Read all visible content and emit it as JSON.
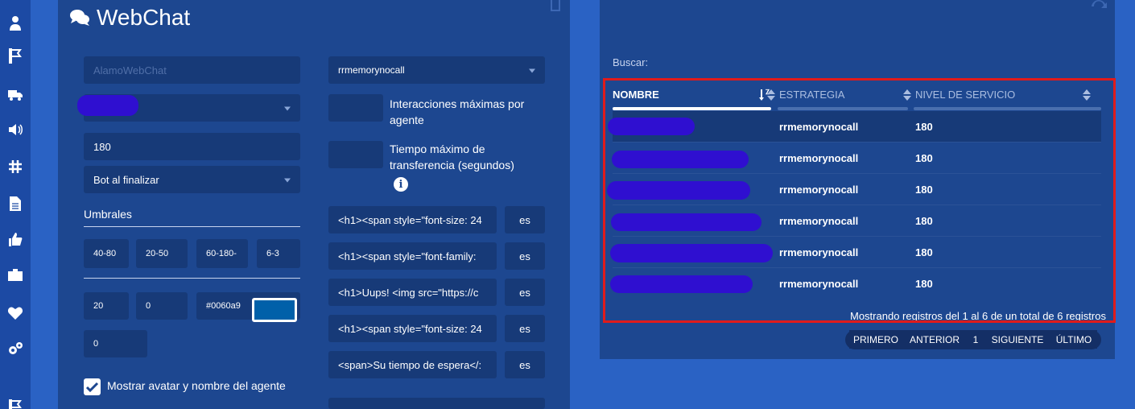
{
  "sidebar": {
    "icons": [
      "user-icon",
      "flag-icon",
      "truck-icon",
      "volume-icon",
      "hashtag-icon",
      "file-icon",
      "thumbs-up-icon",
      "briefcase-icon",
      "heartbeat-icon",
      "cogs-icon",
      "flag-icon"
    ]
  },
  "form": {
    "title": "WebChat",
    "name_placeholder": "AlamoWebChat",
    "timeout_value": "180",
    "end_action": "Bot al finalizar",
    "thresholds_label": "Umbrales",
    "thresholds": [
      "40-80",
      "20-50",
      "60-180-",
      "6-3"
    ],
    "values_row": [
      "20",
      "0",
      "#0060a9"
    ],
    "extra_value": "0",
    "swatch_color": "#0060a9",
    "strategy_select": "rrmemorynocall",
    "max_interactions_label": "Interacciones máximas por agente",
    "max_transfer_label": "Tiempo máximo de transferencia (segundos)",
    "info_glyph": "i",
    "messages": [
      {
        "text": "<h1><span style=\"font-size: 24",
        "lang": "es"
      },
      {
        "text": "<h1><span style=\"font-family:",
        "lang": "es"
      },
      {
        "text": "<h1>Uups! <img src=\"https://c",
        "lang": "es"
      },
      {
        "text": "<h1><span style=\"font-size: 24",
        "lang": "es"
      },
      {
        "text": "<span>Su tiempo de espera</:",
        "lang": "es"
      }
    ],
    "show_avatar_label": "Mostrar avatar y nombre del agente"
  },
  "list": {
    "search_label": "Buscar:",
    "columns": [
      "NOMBRE",
      "ESTRATEGIA",
      "NIVEL DE SERVICIO"
    ],
    "rows": [
      {
        "strategy": "rrmemorynocall",
        "service_level": "180"
      },
      {
        "strategy": "rrmemorynocall",
        "service_level": "180"
      },
      {
        "strategy": "rrmemorynocall",
        "service_level": "180"
      },
      {
        "strategy": "rrmemorynocall",
        "service_level": "180"
      },
      {
        "strategy": "rrmemorynocall",
        "service_level": "180"
      },
      {
        "strategy": "rrmemorynocall",
        "service_level": "180"
      }
    ],
    "summary": "Mostrando registros del 1 al 6 de un total de 6 registros",
    "pagination": [
      "PRIMERO",
      "ANTERIOR",
      "1",
      "SIGUIENTE",
      "ÚLTIMO"
    ]
  },
  "colors": {
    "background": "#2a62c4",
    "panel": "#1d4790",
    "field": "#173a78",
    "highlight": "#e01b1b",
    "redaction": "#2f0fd0"
  }
}
